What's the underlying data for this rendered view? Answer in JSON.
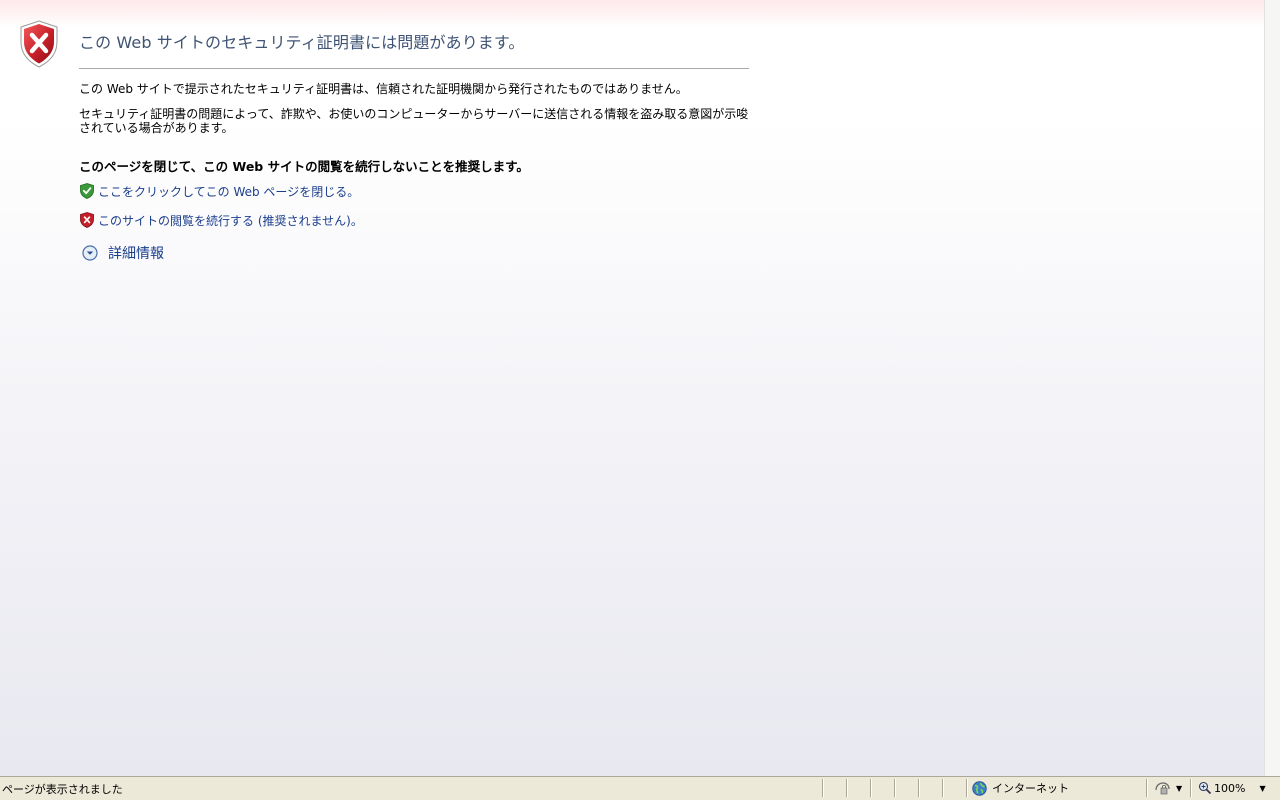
{
  "page": {
    "title": "この Web サイトのセキュリティ証明書には問題があります。",
    "paragraph1": "この Web サイトで提示されたセキュリティ証明書は、信頼された証明機関から発行されたものではありません。",
    "paragraph2": "セキュリティ証明書の問題によって、詐欺や、お使いのコンピューターからサーバーに送信される情報を盗み取る意図が示唆されている場合があります。",
    "recommendation": "このページを閉じて、この Web サイトの閲覧を続行しないことを推奨します。",
    "links": {
      "close_page": "ここをクリックしてこの Web ページを閉じる。",
      "continue_site": "このサイトの閲覧を続行する (推奨されません)。"
    },
    "more_info": "詳細情報"
  },
  "statusbar": {
    "status_text": "ページが表示されました",
    "zone": "インターネット",
    "zoom": "100%"
  },
  "colors": {
    "title": "#3f5375",
    "link": "#1a3e8c",
    "shield_red": "#c8202a",
    "shield_green": "#3a9a3a",
    "statusbar_bg": "#ece9d8"
  },
  "icons": {
    "main": "error-shield-icon",
    "close_link": "green-shield-icon",
    "continue_link": "red-shield-icon",
    "more_info": "expand-circle-icon",
    "zone": "globe-icon",
    "protected_mode": "protected-mode-icon",
    "zoom": "magnifier-icon"
  }
}
